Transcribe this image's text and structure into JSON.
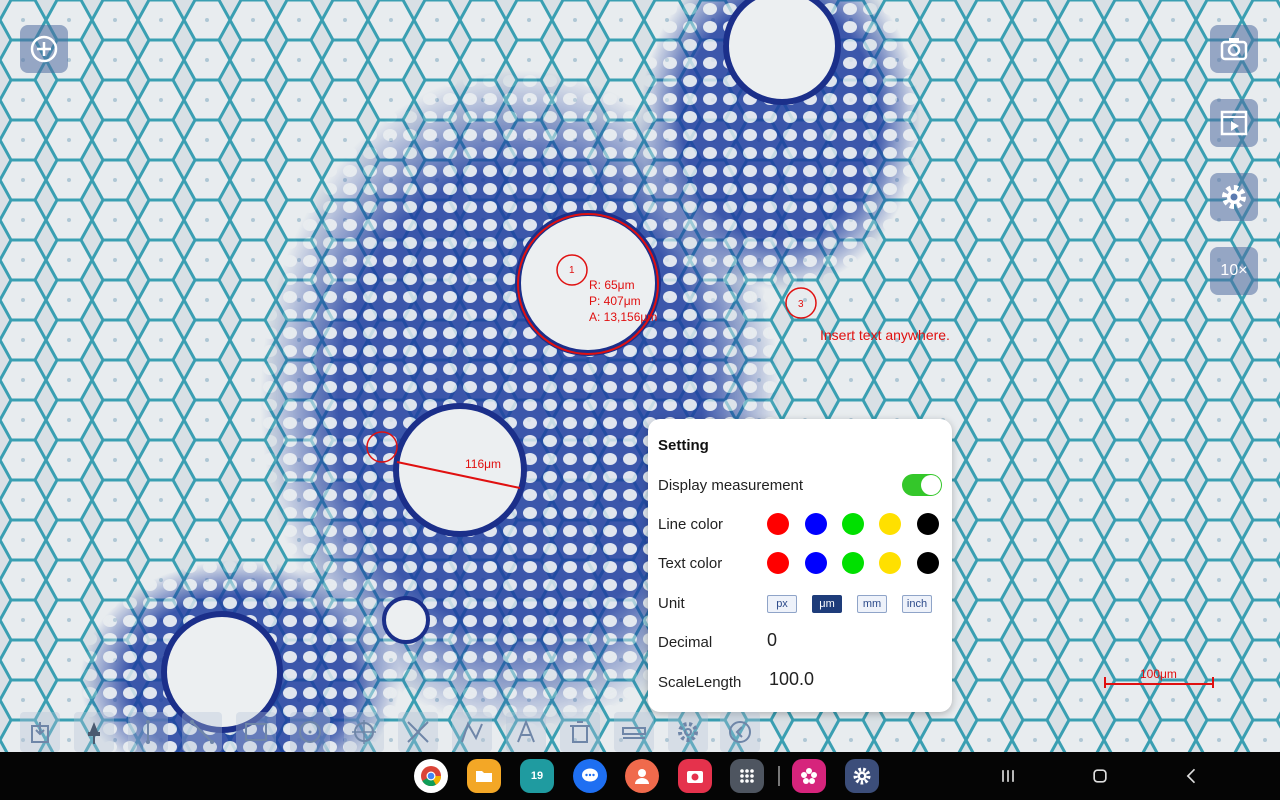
{
  "side_buttons": {
    "add": "add-icon",
    "camera": "camera-icon",
    "video": "video-icon",
    "settings": "gear-icon",
    "zoom_label": "10×"
  },
  "measurements": {
    "circle1_label": "1",
    "circle1_r": "R: 65μm",
    "circle1_p": "P: 407μm",
    "circle1_a": "A: 13,156μm",
    "circle3_label": "3",
    "inserted_text": "Insert text anywhere.",
    "line_length": "116μm",
    "scale_bar": "100μm"
  },
  "settings_panel": {
    "title": "Setting",
    "display_measurement": "Display measurement",
    "display_measurement_on": true,
    "line_color": "Line color",
    "text_color": "Text color",
    "colors": [
      "#ff0000",
      "#0000ff",
      "#00e000",
      "#ffe000",
      "#000000"
    ],
    "unit": "Unit",
    "units": [
      "px",
      "μm",
      "mm",
      "inch"
    ],
    "active_unit": "μm",
    "decimal": "Decimal",
    "decimal_value": "0",
    "scale_length": "ScaleLength",
    "scale_length_value": "100.0"
  },
  "toolbar": [
    "export-icon",
    "pin-icon",
    "vertical-line-icon",
    "line-icon",
    "rectangle-icon",
    "circle-icon",
    "crosshair-circle-icon",
    "angle-icon",
    "polyline-icon",
    "text-icon",
    "trash-icon",
    "scale-bar-icon",
    "gear-icon",
    "back-icon"
  ],
  "taskbar": {
    "apps": [
      "chrome",
      "files",
      "calendar",
      "messages",
      "contacts",
      "camera",
      "app-drawer",
      "flower-app",
      "settings"
    ],
    "calendar_day": "19"
  }
}
